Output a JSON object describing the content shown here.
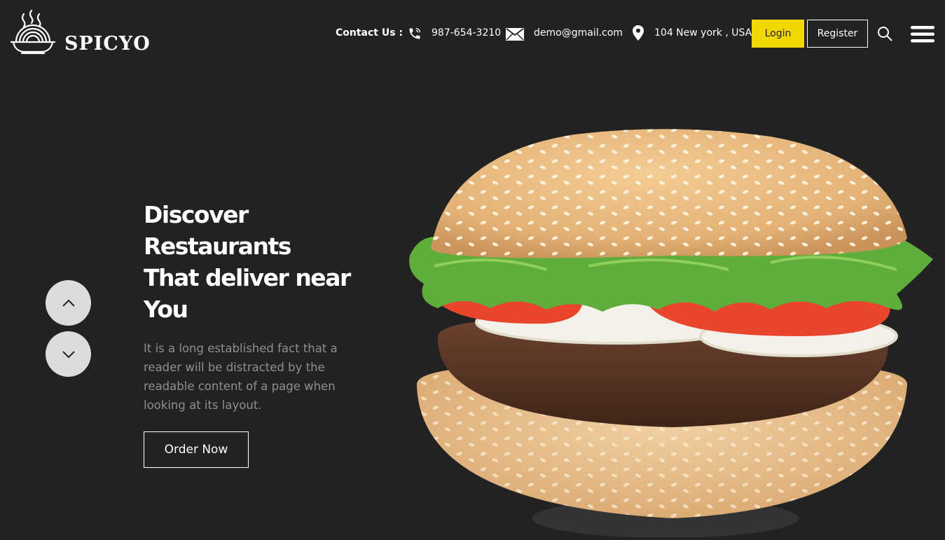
{
  "brand": {
    "name": "SPICYO"
  },
  "header": {
    "contact_label": "Contact Us :",
    "phone": "987-654-3210",
    "email": "demo@gmail.com",
    "address": "104 New york , USA",
    "login_label": "Login",
    "register_label": "Register"
  },
  "hero": {
    "title_lines": [
      "Discover",
      "Restaurants",
      "That deliver near",
      "You"
    ],
    "text_lines": [
      "It is a long established fact that a",
      "reader will be distracted by the",
      "readable content of a page when",
      "looking at its layout."
    ],
    "order_label": "Order Now"
  },
  "colors": {
    "background": "#222222",
    "accent": "#f0d800",
    "muted_text": "#8f8f8f",
    "slider_button": "#dcdcdc"
  },
  "icons": {
    "logo": "noodle-bowl-icon",
    "phone": "phone-icon",
    "email": "envelope-icon",
    "address": "location-pin-icon",
    "search": "search-icon",
    "menu": "hamburger-menu-icon",
    "prev_slide": "chevron-up-icon",
    "next_slide": "chevron-down-icon"
  }
}
